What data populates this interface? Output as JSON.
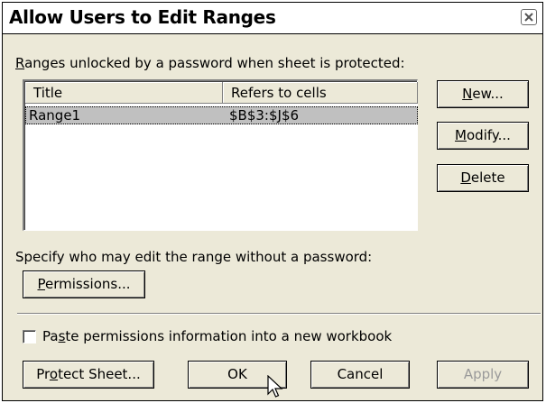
{
  "dialog": {
    "title": "Allow Users to Edit Ranges",
    "close_icon": "close-icon"
  },
  "ranges_section": {
    "label_accesskey": "R",
    "label_rest": "anges unlocked by a password when sheet is protected:",
    "columns": [
      "Title",
      "Refers to cells"
    ],
    "rows": [
      {
        "title": "Range1",
        "refers_to": "$B$3:$J$6",
        "selected": true
      }
    ]
  },
  "side_buttons": {
    "new_accesskey": "N",
    "new_rest": "ew...",
    "modify_accesskey": "M",
    "modify_rest": "odify...",
    "delete_accesskey": "D",
    "delete_rest": "elete"
  },
  "permissions_section": {
    "label": "Specify who may edit the range without a password:",
    "button_accesskey": "P",
    "button_rest": "ermissions..."
  },
  "paste_option": {
    "checked": false,
    "label_pre": "Pa",
    "label_accesskey": "s",
    "label_post": "te permissions information into a new workbook"
  },
  "footer_buttons": {
    "protect_pre": "Pr",
    "protect_accesskey": "o",
    "protect_post": "tect Sheet...",
    "ok": "OK",
    "cancel": "Cancel",
    "apply": "Apply",
    "apply_enabled": false
  },
  "pointer": {
    "icon": "arrow-cursor-icon"
  }
}
